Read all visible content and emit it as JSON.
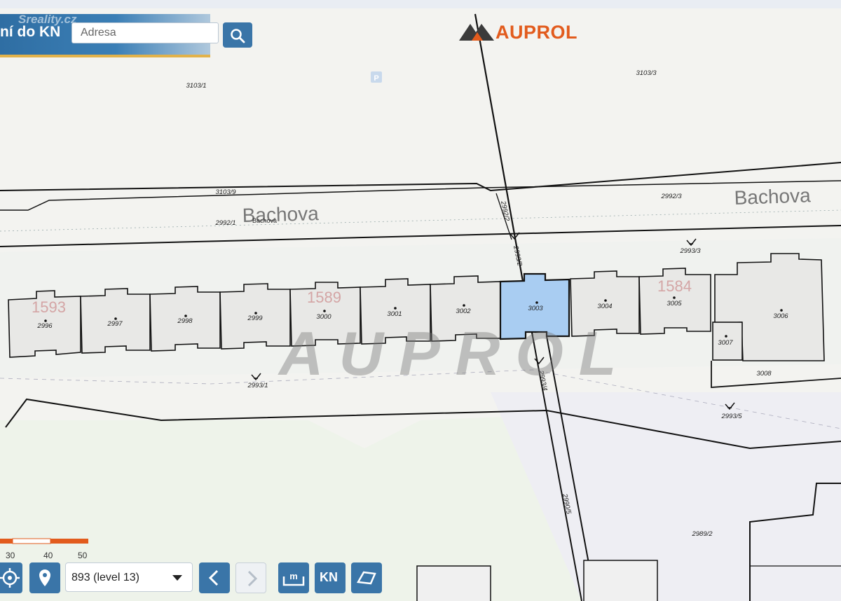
{
  "header": {
    "brand_watermark": "Sreality.cz",
    "panel_title": "ní do KN"
  },
  "search": {
    "placeholder": "Adresa",
    "value": ""
  },
  "logo": {
    "text": "AUPROL"
  },
  "watermark": "AUPROL",
  "map": {
    "street_name": "Bachova",
    "street_name_small": "Bachova",
    "parcels": [
      "2996",
      "2997",
      "2998",
      "2999",
      "3000",
      "3001",
      "3002",
      "3003",
      "3004",
      "3005",
      "3006",
      "3007",
      "3008"
    ],
    "selected_parcel": "3003",
    "labels": {
      "p3103_1": "3103/1",
      "p3103_3": "3103/3",
      "p3103_9": "3103/9",
      "p2992_1": "2992/1",
      "p2992_3": "2992/3",
      "p2993_1": "2993/1",
      "p2993_3": "2993/3",
      "p2993_5": "2993/5",
      "p2989_2": "2989/2",
      "p2992_v": "2992/2",
      "p2993_v": "2993/2",
      "p2993_4": "2993/4",
      "p2990_v": "2990/5"
    },
    "house_numbers": {
      "h1593": "1593",
      "h1589": "1589",
      "h1584": "1584"
    },
    "parking_symbol": "P",
    "colors": {
      "selected_fill": "#a9cdf2",
      "parcel_fill": "#e8e8e6",
      "line": "#111111",
      "house_number": "#d4a5a5",
      "accent": "#3a75a8",
      "logo": "#e25b1d"
    }
  },
  "scale": {
    "labels": [
      "30",
      "40",
      "50 m"
    ]
  },
  "controls": {
    "level_select": "893 (level 13)",
    "kn_label": "KN"
  }
}
